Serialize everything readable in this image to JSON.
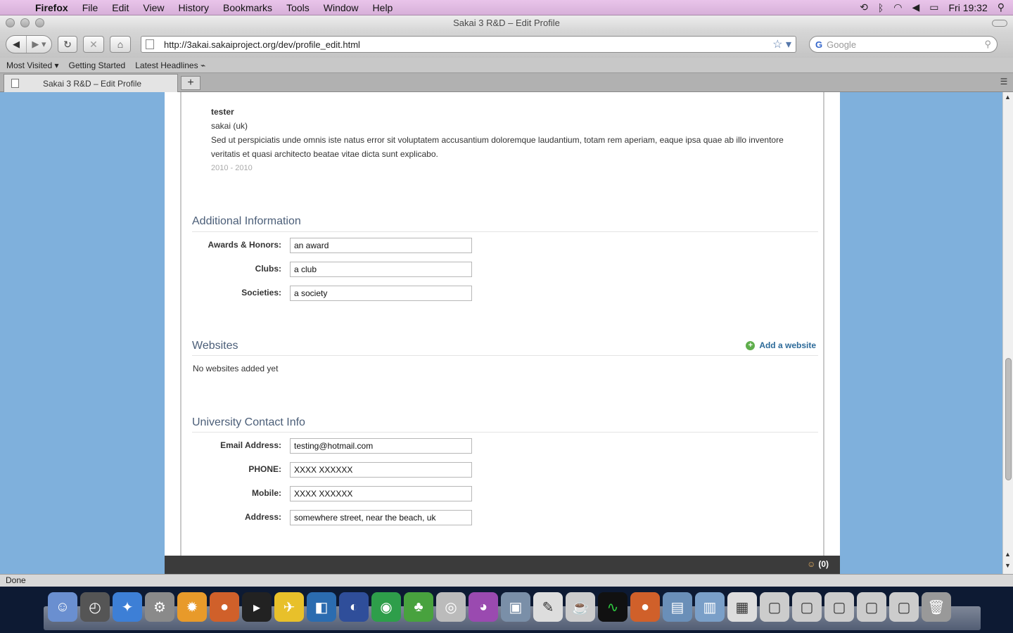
{
  "menubar": {
    "apple": "",
    "app": "Firefox",
    "items": [
      "File",
      "Edit",
      "View",
      "History",
      "Bookmarks",
      "Tools",
      "Window",
      "Help"
    ],
    "clock": "Fri 19:32"
  },
  "window": {
    "title": "Sakai 3 R&D – Edit Profile"
  },
  "nav": {
    "url": "http://3akai.sakaiproject.org/dev/profile_edit.html",
    "search_placeholder": "Google"
  },
  "bookmarks": [
    "Most Visited ▾",
    "Getting Started",
    "Latest Headlines"
  ],
  "tab": {
    "title": "Sakai 3 R&D – Edit Profile"
  },
  "education": {
    "name": "tester",
    "org": "sakai (uk)",
    "description": "Sed ut perspiciatis unde omnis iste natus error sit voluptatem accusantium doloremque laudantium, totam rem aperiam, eaque ipsa quae ab illo inventore veritatis et quasi architecto beatae vitae dicta sunt explicabo.",
    "dates": "2010 - 2010"
  },
  "additional": {
    "title": "Additional Information",
    "fields": [
      {
        "label": "Awards & Honors:",
        "value": "an award"
      },
      {
        "label": "Clubs:",
        "value": "a club"
      },
      {
        "label": "Societies:",
        "value": "a society"
      }
    ]
  },
  "websites": {
    "title": "Websites",
    "add_label": "Add a website",
    "empty": "No websites added yet"
  },
  "contact": {
    "title": "University Contact Info",
    "fields": [
      {
        "label": "Email Address:",
        "value": "testing@hotmail.com"
      },
      {
        "label": "PHONE:",
        "value": "XXXX XXXXXX"
      },
      {
        "label": "Mobile:",
        "value": "XXXX XXXXXX"
      },
      {
        "label": "Address:",
        "value": "somewhere street, near the beach, uk"
      }
    ]
  },
  "footer": {
    "chat_count": "(0)"
  },
  "status": {
    "text": "Done"
  }
}
